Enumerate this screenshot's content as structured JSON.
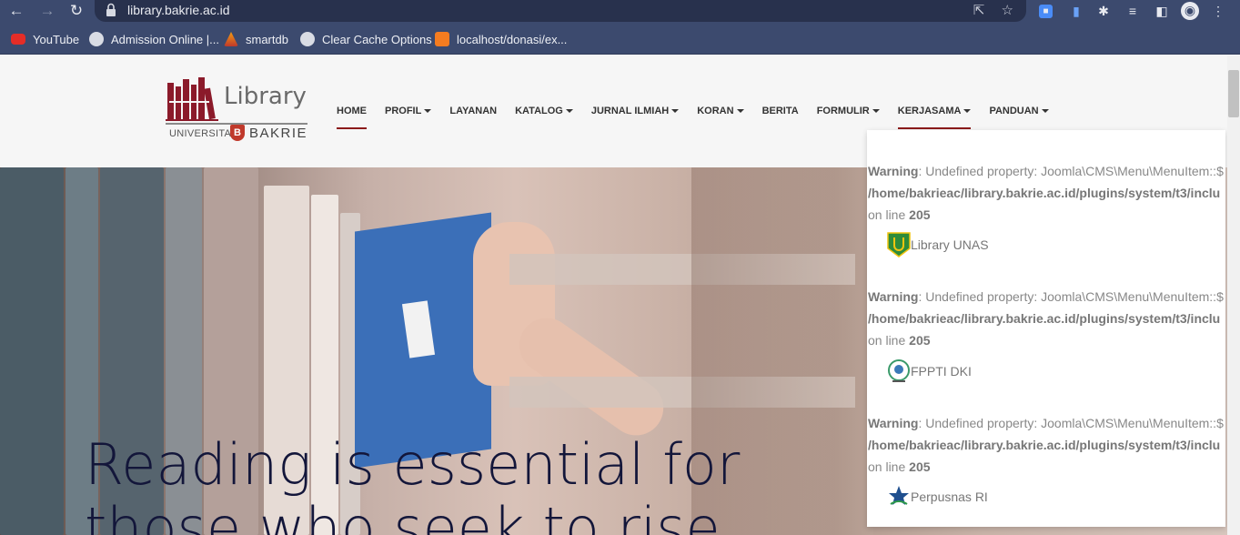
{
  "browser": {
    "url": "library.bakrie.ac.id",
    "bookmarks": [
      {
        "label": "YouTube"
      },
      {
        "label": "Admission Online |..."
      },
      {
        "label": "smartdb"
      },
      {
        "label": "Clear Cache Options"
      },
      {
        "label": "localhost/donasi/ex..."
      }
    ]
  },
  "logo": {
    "word": "Library",
    "university": "UNIVERSITAS",
    "shield": "B",
    "name": "BAKRIE"
  },
  "menu": [
    {
      "label": "HOME",
      "active": true,
      "dropdown": false
    },
    {
      "label": "PROFIL",
      "dropdown": true
    },
    {
      "label": "LAYANAN",
      "dropdown": false
    },
    {
      "label": "KATALOG",
      "dropdown": true
    },
    {
      "label": "JURNAL ILMIAH",
      "dropdown": true
    },
    {
      "label": "KORAN",
      "dropdown": true
    },
    {
      "label": "BERITA",
      "dropdown": false
    },
    {
      "label": "FORMULIR",
      "dropdown": true
    },
    {
      "label": "KERJASAMA",
      "active": true,
      "dropdown": true
    },
    {
      "label": "PANDUAN",
      "dropdown": true
    }
  ],
  "hero": {
    "line1": "Reading is essential for",
    "line2": "those who seek to rise"
  },
  "dropdown": {
    "warnings": [
      {
        "label": "Warning",
        "text": ": Undefined property: Joomla\\CMS\\Menu\\MenuItem::$",
        "path": "/home/bakrieac/library.bakrie.ac.id/plugins/system/t3/inclu",
        "on_line": "on line",
        "line": "205",
        "partner": "Library UNAS"
      },
      {
        "label": "Warning",
        "text": ": Undefined property: Joomla\\CMS\\Menu\\MenuItem::$",
        "path": "/home/bakrieac/library.bakrie.ac.id/plugins/system/t3/inclu",
        "on_line": "on line",
        "line": "205",
        "partner": "FPPTI DKI"
      },
      {
        "label": "Warning",
        "text": ": Undefined property: Joomla\\CMS\\Menu\\MenuItem::$",
        "path": "/home/bakrieac/library.bakrie.ac.id/plugins/system/t3/inclu",
        "on_line": "on line",
        "line": "205",
        "partner": "Perpusnas RI"
      }
    ]
  },
  "colors": {
    "chrome": "#3c4a6e",
    "accent": "#8b1a1a",
    "hero_text": "#13163a"
  }
}
